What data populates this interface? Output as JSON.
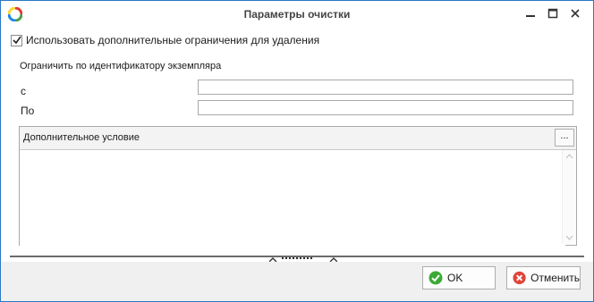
{
  "window": {
    "title": "Параметры очистки",
    "accent_color": "#2b78c6"
  },
  "form": {
    "use_restrictions": {
      "label": "Использовать дополнительные ограничения для удаления",
      "checked": true
    },
    "section_label": "Ограничить по идентификатору экземпляра",
    "from": {
      "label": "с",
      "value": ""
    },
    "to": {
      "label": "По",
      "value": ""
    },
    "condition": {
      "title": "Дополнительное условие",
      "button_label": "...",
      "value": ""
    }
  },
  "footer": {
    "ok_label": "OK",
    "cancel_label": "Отменить",
    "ok_color": "#3aaa35",
    "cancel_color": "#e0443a"
  },
  "icons": {
    "app": "app-logo-icon",
    "minimize": "minimize-icon",
    "maximize": "maximize-icon",
    "close": "close-icon",
    "ok": "check-circle-icon",
    "cancel": "cancel-circle-icon"
  }
}
